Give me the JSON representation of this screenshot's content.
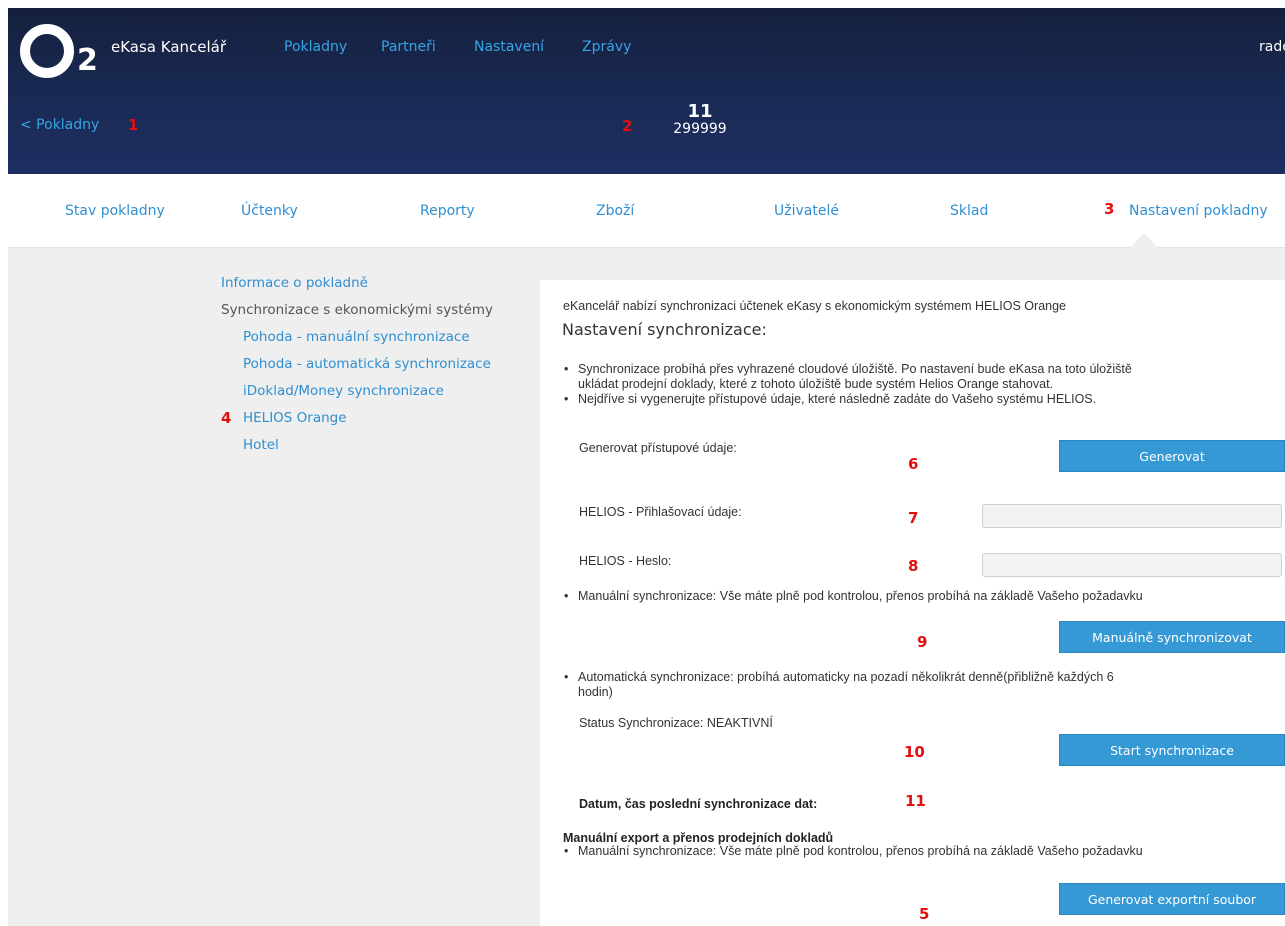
{
  "header": {
    "logo_letter": "O",
    "logo_sub": "2",
    "app_name": "eKasa Kancelář",
    "nav": [
      "Pokladny",
      "Partneři",
      "Nastavení",
      "Zprávy"
    ],
    "user": "radek"
  },
  "subheader": {
    "back_link": "< Pokladny",
    "cash_register_number": "11",
    "cash_register_code": "299999"
  },
  "tabs": [
    "Stav pokladny",
    "Účtenky",
    "Reporty",
    "Zboží",
    "Uživatelé",
    "Sklad",
    "Nastavení pokladny"
  ],
  "sidebar": {
    "info": "Informace o pokladně",
    "sync_header": "Synchronizace s ekonomickými systémy",
    "items": [
      "Pohoda - manuální synchronizace",
      "Pohoda - automatická synchronizace",
      "iDoklad/Money synchronizace",
      "HELIOS Orange",
      "Hotel"
    ]
  },
  "main": {
    "intro": "eKancelář nabízí synchronizaci účtenek eKasy s ekonomickým systémem HELIOS Orange",
    "title": "Nastavení synchronizace:",
    "bullet1_line1": "Synchronizace probíhá přes vyhrazené cloudové úložiště. Po nastavení bude eKasa na toto úložiště",
    "bullet1_line2": "ukládat prodejní doklady, které z tohoto úložiště bude systém Helios Orange stahovat.",
    "bullet2": "Nejdříve si vygenerujte přístupové údaje, které následně zadáte do Vašeho systému HELIOS.",
    "generate_label": "Generovat přístupové údaje:",
    "generate_button": "Generovat",
    "login_label": "HELIOS - Přihlašovací údaje:",
    "password_label": "HELIOS - Heslo:",
    "manual_bullet": "Manuální synchronizace: Vše máte plně pod kontrolou, přenos probíhá na základě Vašeho požadavku",
    "manual_button": "Manuálně synchronizovat",
    "auto_bullet_line1": "Automatická synchronizace: probíhá automaticky na pozadí několikrát denně(přibližně každých 6",
    "auto_bullet_line2": "hodin)",
    "status_text": "Status Synchronizace: NEAKTIVNÍ",
    "start_button": "Start synchronizace",
    "last_sync_label": "Datum, čas poslední synchronizace dat:",
    "export_title": "Manuální export a přenos prodejních dokladů",
    "export_bullet": "Manuální synchronizace: Vše máte plně pod kontrolou, přenos probíhá na základě Vašeho požadavku",
    "export_button": "Generovat exportní soubor"
  },
  "annotations": [
    "1",
    "2",
    "3",
    "4",
    "5",
    "6",
    "7",
    "8",
    "9",
    "10",
    "11"
  ],
  "colors": {
    "header_bg": "#1a2a55",
    "link": "#2f8fd0",
    "button": "#3599d6",
    "annotation": "#e01010"
  }
}
